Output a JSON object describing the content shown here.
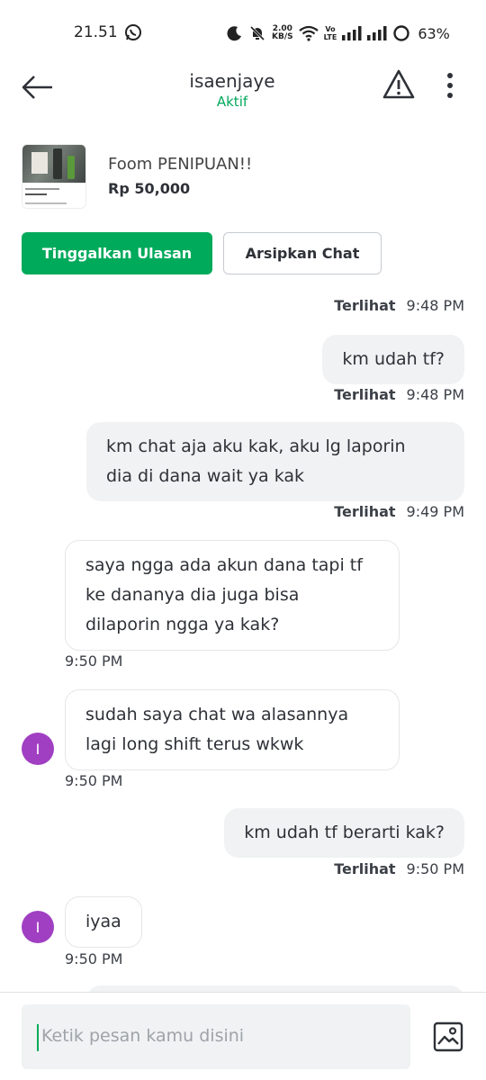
{
  "status_bar": {
    "time": "21.51",
    "net_speed_value": "2.00",
    "net_speed_unit": "KB/S",
    "volte_top": "Vo",
    "volte_bottom": "LTE",
    "battery": "63%"
  },
  "header": {
    "title": "isaenjaye",
    "status": "Aktif"
  },
  "product": {
    "name": "Foom PENIPUAN!!",
    "price": "Rp 50,000"
  },
  "actions": {
    "review_label": "Tinggalkan Ulasan",
    "archive_label": "Arsipkan Chat"
  },
  "chat": {
    "partial_top": {
      "seen": "Terlihat",
      "time": "9:48 PM"
    },
    "messages": [
      {
        "dir": "out",
        "text": "km udah tf?",
        "seen": "Terlihat",
        "time": "9:48 PM"
      },
      {
        "dir": "out",
        "lines": [
          "km chat aja aku kak, aku lg laporin",
          "dia di dana wait ya kak"
        ],
        "seen": "Terlihat",
        "time": "9:49 PM"
      },
      {
        "dir": "in",
        "lines": [
          "saya ngga ada akun dana tapi tf",
          "ke dananya dia juga bisa",
          "dilaporin ngga ya kak?"
        ],
        "time": "9:50 PM"
      },
      {
        "dir": "in",
        "lines": [
          "sudah saya chat wa alasannya",
          "lagi long shift terus wkwk"
        ],
        "time": "9:50 PM",
        "avatar": "I"
      },
      {
        "dir": "out",
        "text": "km udah tf berarti kak?",
        "seen": "Terlihat",
        "time": "9:50 PM"
      },
      {
        "dir": "in",
        "text": "iyaa",
        "time": "9:50 PM",
        "avatar": "I"
      }
    ]
  },
  "composer": {
    "placeholder": "Ketik pesan kamu disini"
  },
  "colors": {
    "accent": "#00aa5b",
    "avatar": "#a03fc2",
    "bubble_out": "#f0f2f3"
  }
}
